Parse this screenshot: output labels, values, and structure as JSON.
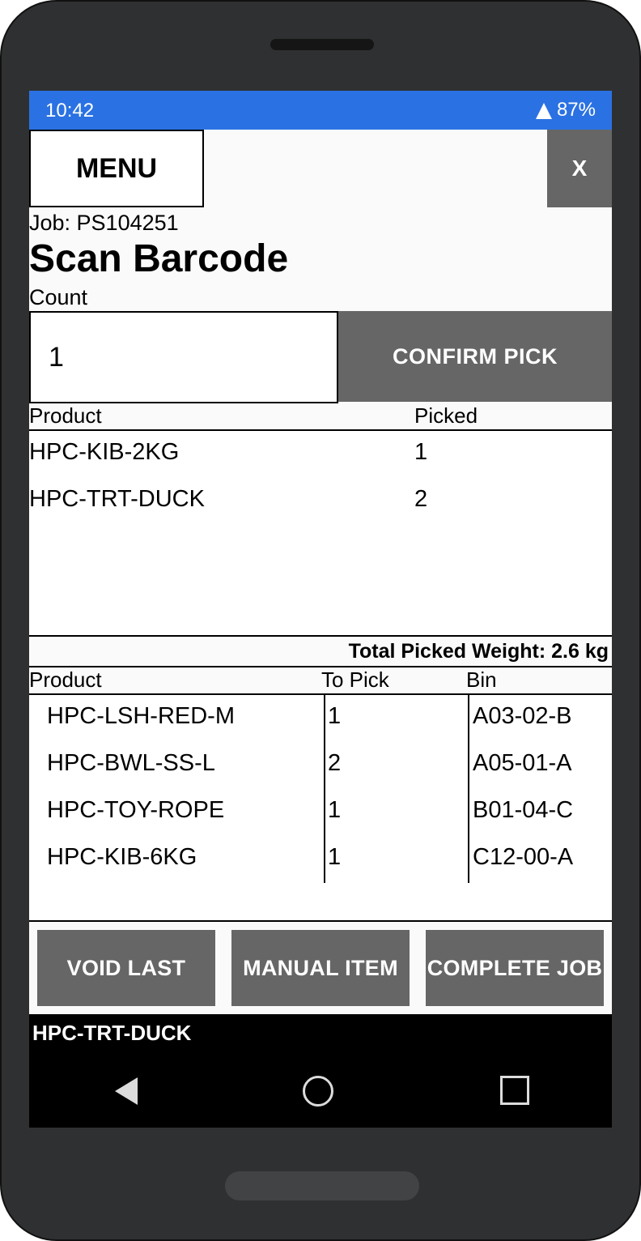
{
  "status_bar": {
    "time": "10:42",
    "battery": "87%"
  },
  "header": {
    "menu_label": "MENU",
    "close_label": "X"
  },
  "job": {
    "label": "Job: PS104251",
    "title": "Scan Barcode"
  },
  "count": {
    "label": "Count",
    "value": "1",
    "confirm_label": "CONFIRM PICK"
  },
  "picked_table": {
    "headers": [
      "Product",
      "Picked"
    ],
    "rows": [
      {
        "product": "HPC-KIB-2KG",
        "picked": "1"
      },
      {
        "product": "HPC-TRT-DUCK",
        "picked": "2"
      }
    ]
  },
  "total_weight": "Total Picked Weight: 2.6 kg",
  "to_pick_table": {
    "headers": [
      "Product",
      "To Pick",
      "Bin"
    ],
    "rows": [
      {
        "product": "HPC-LSH-RED-M",
        "to_pick": "1",
        "bin": "A03-02-B"
      },
      {
        "product": "HPC-BWL-SS-L",
        "to_pick": "2",
        "bin": "A05-01-A"
      },
      {
        "product": "HPC-TOY-ROPE",
        "to_pick": "1",
        "bin": "B01-04-C"
      },
      {
        "product": "HPC-KIB-6KG",
        "to_pick": "1",
        "bin": "C12-00-A"
      }
    ]
  },
  "actions": {
    "void_last": "VOID LAST",
    "manual_item": "MANUAL ITEM",
    "complete_job": "COMPLETE JOB"
  },
  "last_scanned": "HPC-TRT-DUCK",
  "colors": {
    "status_bar": "#2a71e3",
    "button_gray": "#666666",
    "phone_body": "#2f3032"
  }
}
